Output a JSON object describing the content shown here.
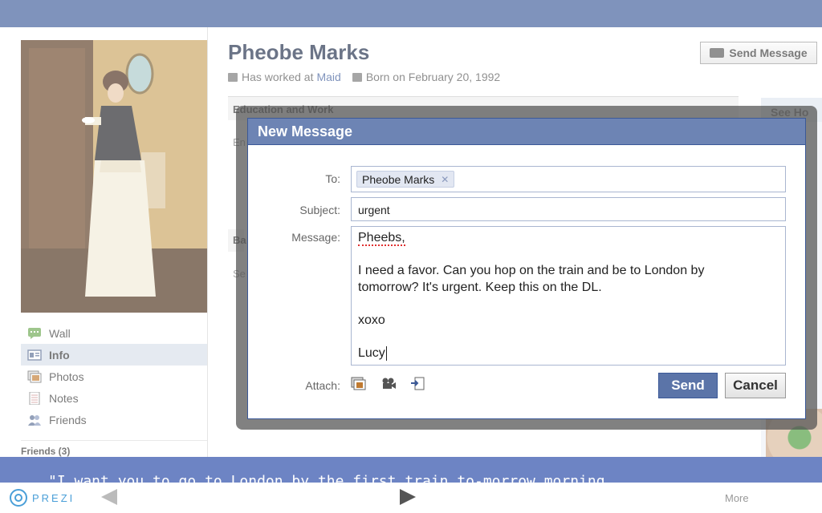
{
  "profile": {
    "name": "Pheobe Marks",
    "worked_prefix": "Has worked at",
    "worked_link": "Maid",
    "born": "Born on February 20, 1992",
    "send_message_label": "Send Message"
  },
  "sections": {
    "education_work": "Education and Work",
    "basic_frag": "Ba",
    "side_frag_1": "En",
    "side_frag_2": "Se",
    "right_title": "See Ho"
  },
  "leftnav": {
    "items": [
      {
        "label": "Wall",
        "icon": "wall-icon"
      },
      {
        "label": "Info",
        "icon": "info-icon"
      },
      {
        "label": "Photos",
        "icon": "photos-icon"
      },
      {
        "label": "Notes",
        "icon": "notes-icon"
      },
      {
        "label": "Friends",
        "icon": "friends-icon"
      }
    ],
    "friends_section": "Friends (3)"
  },
  "dialog": {
    "title": "New Message",
    "to_label": "To:",
    "to_recipient": "Pheobe Marks",
    "subject_label": "Subject:",
    "subject_value": "urgent",
    "message_label": "Message:",
    "message_greeting": "Pheebs,",
    "message_line1": "I need a favor. Can you hop on the train and be to London by",
    "message_line2": "tomorrow? It's urgent. Keep this on the DL.",
    "message_signoff": "xoxo",
    "message_name": "Lucy",
    "attach_label": "Attach:",
    "attach_icons": [
      "photo-attach-icon",
      "video-attach-icon",
      "link-attach-icon"
    ],
    "send_label": "Send",
    "cancel_label": "Cancel"
  },
  "caption": {
    "text": "\"I want you to go to London by the first train to-morrow morning"
  },
  "prezi": {
    "logo_text": "PREZI",
    "more_label": "More"
  },
  "colors": {
    "facebook_blue": "#3b5998",
    "dialog_header": "#6d84b4",
    "caption_bar": "#6d84c4",
    "prezi_blue": "#4a9fd8"
  }
}
